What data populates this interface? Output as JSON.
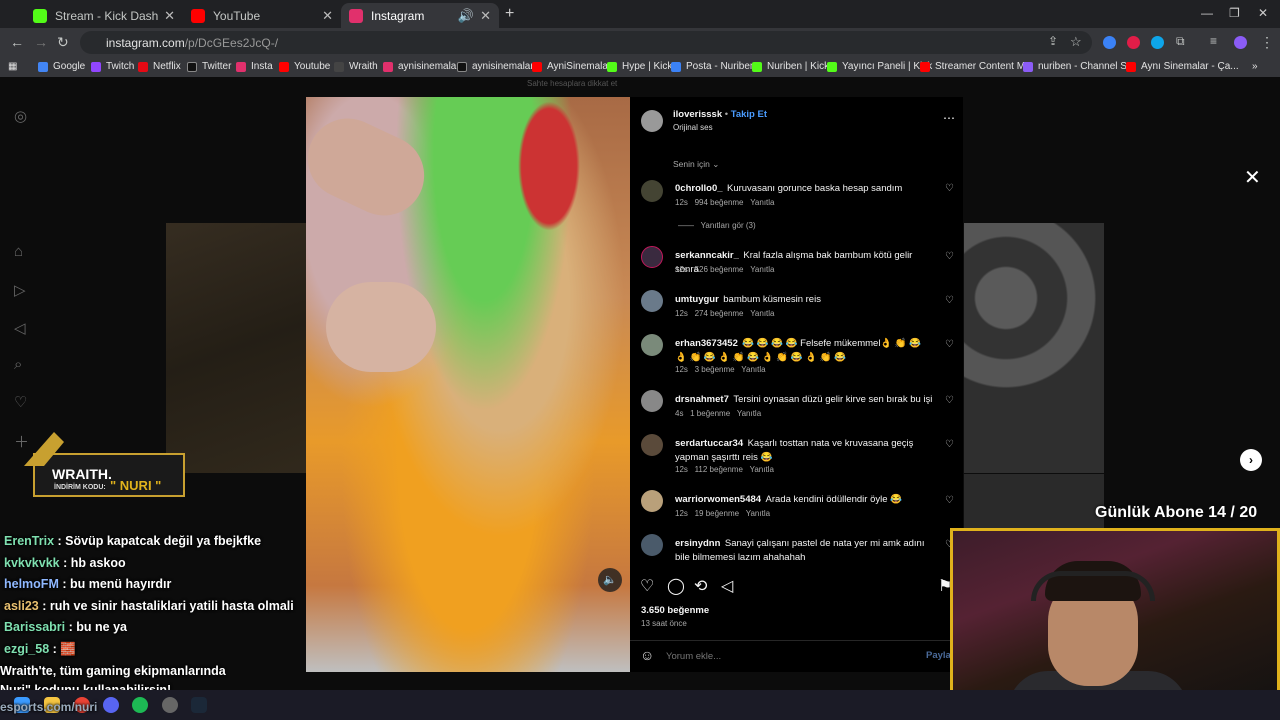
{
  "tabs": [
    {
      "title": "Stream - Kick Dashboard",
      "color": "#53fc18"
    },
    {
      "title": "YouTube",
      "color": "#ff0000"
    },
    {
      "title": "Instagram",
      "color": "#e1306c"
    }
  ],
  "url": {
    "host": "instagram.com",
    "path": "/p/DcGEes2JcQ-/"
  },
  "bookmarks": [
    "Google",
    "Twitch",
    "Netflix",
    "Twitter",
    "Insta",
    "Youtube",
    "Wraith",
    "aynisinemalar",
    "aynisinemalar",
    "AyniSinemalar",
    "Hype | Kick",
    "Posta - Nuriben",
    "Nuriben | Kick",
    "Yayıncı Paneli | Kick",
    "Streamer Content M...",
    "nuriben - Channel S...",
    "Aynı Sinemalar - Ça..."
  ],
  "post": {
    "author": "iloverisssk",
    "follow": "Takip Et",
    "audio": "Orijinal ses",
    "sort": "Senin için",
    "likes": "3.650 beğenme",
    "time": "13 saat önce",
    "comment_placeholder": "Yorum ekle...",
    "post_button": "Payla",
    "header_fade": "Sahte hesaplara dikkat et"
  },
  "comments": [
    {
      "user": "0chrollo0_",
      "text": "Kuruvasanı gorunce baska hesap sandım",
      "age": "12s",
      "likes": "994 beğenme",
      "reply": "Yanıtla",
      "view_replies": "Yanıtları gör (3)"
    },
    {
      "user": "serkanncakir_",
      "text": "Kral fazla alışma bak bambum kötü gelir sonra",
      "age": "12s",
      "likes": "526 beğenme",
      "reply": "Yanıtla"
    },
    {
      "user": "umtuygur",
      "text": "bambum küsmesin reis",
      "age": "12s",
      "likes": "274 beğenme",
      "reply": "Yanıtla"
    },
    {
      "user": "erhan3673452",
      "text": "😂 😂 😂 😂  Felsefe mükemmel👌 👏 😂 👌 👏 😂 👌 👏 😂 👌 👏 😂 👌 👏 😂",
      "age": "12s",
      "likes": "3 beğenme",
      "reply": "Yanıtla"
    },
    {
      "user": "drsnahmet7",
      "text": "Tersini oynasan düzü gelir kirve sen bırak bu işi",
      "age": "4s",
      "likes": "1 beğenme",
      "reply": "Yanıtla"
    },
    {
      "user": "serdartuccar34",
      "text": "Kaşarlı tosttan nata ve kruvasana geçiş yapman şaşırttı reis 😂",
      "age": "12s",
      "likes": "112 beğenme",
      "reply": "Yanıtla"
    },
    {
      "user": "warriorwomen5484",
      "text": "Arada kendini ödüllendir öyle 😂",
      "age": "12s",
      "likes": "19 beğenme",
      "reply": "Yanıtla"
    },
    {
      "user": "ersinydnn",
      "text": "Sanayi çalışanı pastel de nata yer mi amk adını bile bilmemesi lazım ahahahah",
      "age": "",
      "likes": "",
      "reply": ""
    }
  ],
  "chat": [
    {
      "user": "ErenTrix",
      "msg": ": Sövüp kapatcak değil ya fbejkfke",
      "color": "#7fe0b0"
    },
    {
      "user": "kvkvkvkk",
      "msg": ": hb askoo",
      "color": "#7fe0b0"
    },
    {
      "user": "helmoFM",
      "msg": ": bu menü hayırdır",
      "color": "#8fb8ff"
    },
    {
      "user": "asli23",
      "msg": ": ruh ve sinir hastaliklari yatili hasta olmali",
      "color": "#e8c070"
    },
    {
      "user": "Barissabri",
      "msg": ": bu ne ya",
      "color": "#7fe0b0"
    },
    {
      "user": "ezgi_58",
      "msg": ": 🧱",
      "color": "#7fe0b0"
    }
  ],
  "promo": {
    "line1": "Wraith'te, tüm gaming ekipmanlarında",
    "line2": "Nuri\" kodunu kullanabilirsin!",
    "line3": "esports.com/nuri"
  },
  "banner": {
    "brand": "WRAITH.",
    "sub": "İNDİRİM KODU:",
    "code": "\" NURI \""
  },
  "overlay": {
    "subs": "Günlük Abone 14 / 20"
  }
}
